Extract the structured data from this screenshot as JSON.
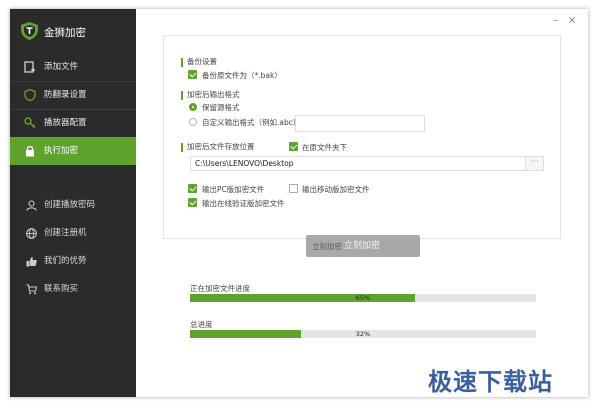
{
  "app": {
    "title": "金狮加密",
    "watermark": "极速下载站"
  },
  "window": {
    "minimize": "–",
    "close": "×"
  },
  "sidebar": {
    "items": [
      {
        "label": "添加文件",
        "icon": "add-file-icon",
        "active": false
      },
      {
        "label": "防翻录设置",
        "icon": "shield-icon",
        "active": false
      },
      {
        "label": "播放器配置",
        "icon": "key-icon",
        "active": false
      },
      {
        "label": "执行加密",
        "icon": "lock-icon",
        "active": true
      }
    ],
    "secondary": [
      {
        "label": "创建播放密码",
        "icon": "user-icon"
      },
      {
        "label": "创建注册机",
        "icon": "globe-icon"
      },
      {
        "label": "我们的优势",
        "icon": "thumbs-up-icon"
      },
      {
        "label": "联系购买",
        "icon": "cart-icon"
      }
    ]
  },
  "backup": {
    "title": "备份设置",
    "backup_label": "备份原文件为（*.bak）",
    "checked": true
  },
  "format": {
    "title": "加密后输出格式",
    "keep_label": "保留源格式",
    "custom_label": "自定义输出格式（例如.abc）",
    "selected": "keep",
    "custom_value": ""
  },
  "output": {
    "title": "加密后文件存放位置",
    "same_folder_label": "在原文件夹下",
    "same_folder_checked": true,
    "path": "C:\\Users\\LENOVO\\Desktop",
    "browse": "···",
    "pc_label": "输出PC版加密文件",
    "pc_checked": true,
    "mobile_label": "输出移动版加密文件",
    "mobile_checked": false,
    "online_label": "输出在线验证版加密文件",
    "online_checked": true
  },
  "actions": {
    "encrypt_label": "立刻加密",
    "encrypt_ghost": "立刻加密"
  },
  "progress": {
    "current_label": "正在加密文件进度",
    "current_value": 0.65,
    "current_text": "65%",
    "total_label": "总进度",
    "total_value": 0.32,
    "total_text": "32%"
  },
  "colors": {
    "accent": "#5fa32c",
    "sidebar": "#2b2b2b",
    "button_disabled": "#a9a9a9"
  }
}
